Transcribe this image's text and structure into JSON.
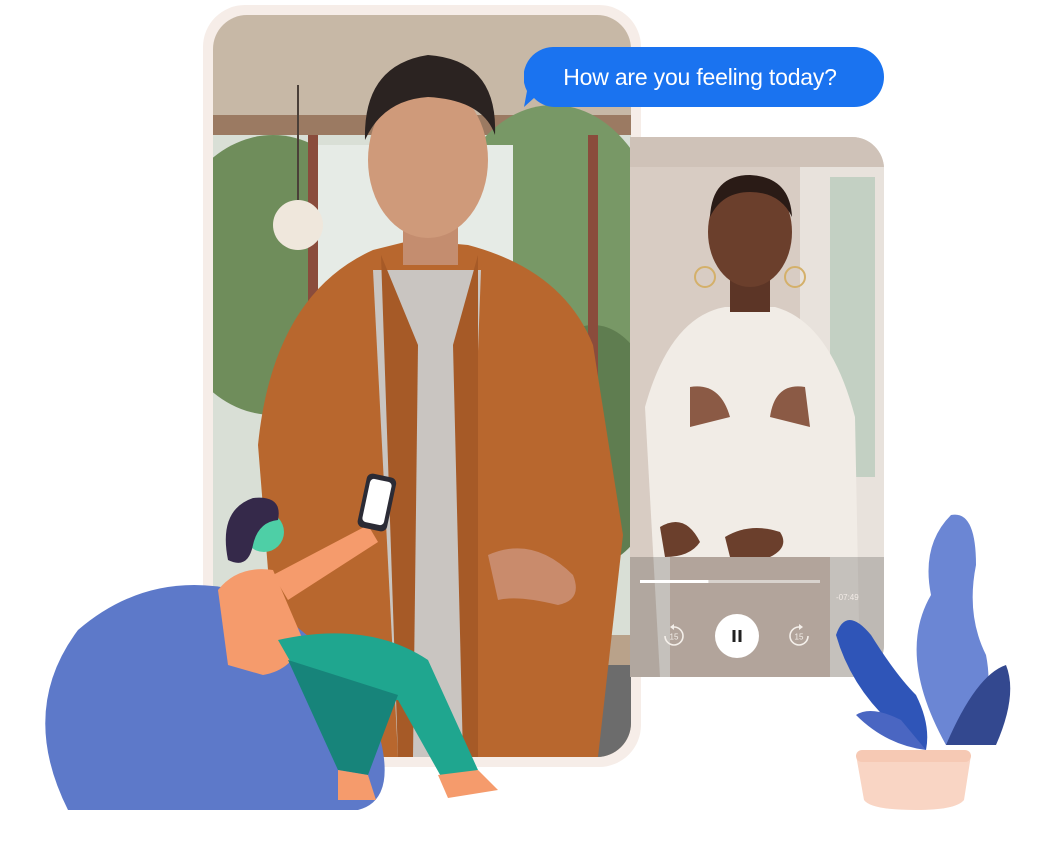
{
  "chat": {
    "message": "How are you feeling today?"
  },
  "video_player": {
    "remaining_time": "-07:49",
    "progress": 0.38,
    "rewind_seconds": "15",
    "forward_seconds": "15"
  },
  "colors": {
    "bubble": "#1a73f0",
    "main_frame": "#f6ede8",
    "jacket": "#b8672e",
    "bean_bag": "#5d79c9",
    "plant_dark": "#2f55b8",
    "pot": "#f9d5c4"
  },
  "icons": {
    "rewind": "rewind-15-icon",
    "pause": "pause-icon",
    "forward": "forward-15-icon"
  }
}
